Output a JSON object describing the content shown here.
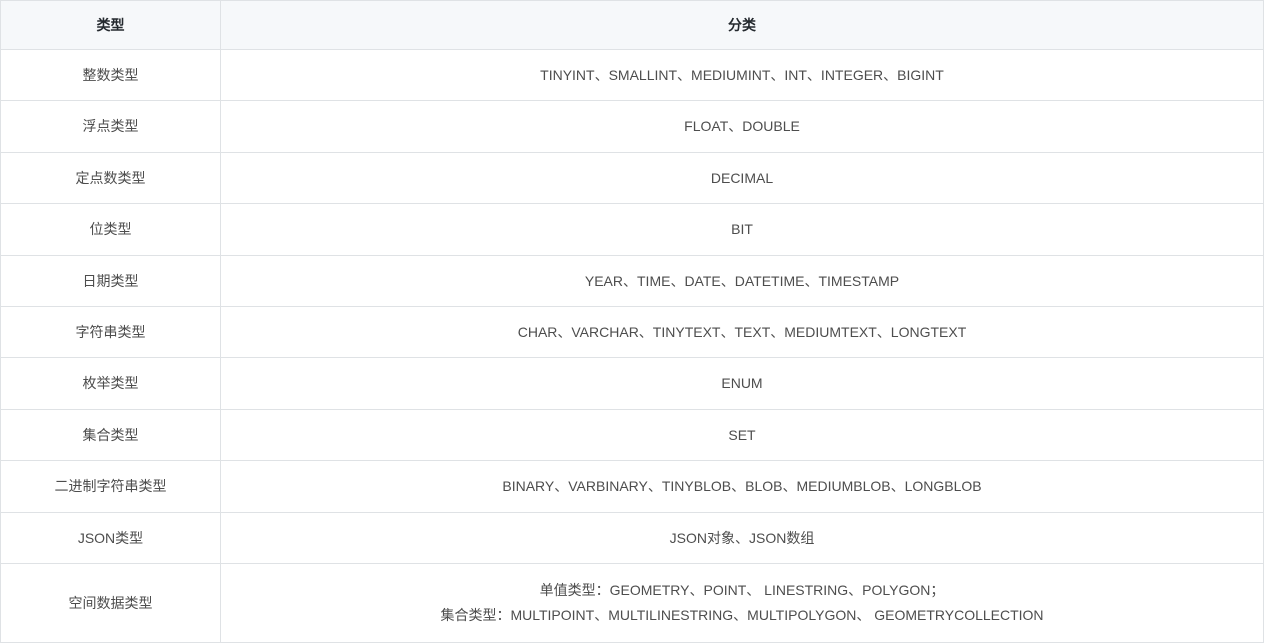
{
  "table": {
    "headers": {
      "col1": "类型",
      "col2": "分类"
    },
    "rows": [
      {
        "type": "整数类型",
        "category": "TINYINT、SMALLINT、MEDIUMINT、INT、INTEGER、BIGINT"
      },
      {
        "type": "浮点类型",
        "category": "FLOAT、DOUBLE"
      },
      {
        "type": "定点数类型",
        "category": "DECIMAL"
      },
      {
        "type": "位类型",
        "category": "BIT"
      },
      {
        "type": "日期类型",
        "category": "YEAR、TIME、DATE、DATETIME、TIMESTAMP"
      },
      {
        "type": "字符串类型",
        "category": "CHAR、VARCHAR、TINYTEXT、TEXT、MEDIUMTEXT、LONGTEXT"
      },
      {
        "type": "枚举类型",
        "category": "ENUM"
      },
      {
        "type": "集合类型",
        "category": "SET"
      },
      {
        "type": "二进制字符串类型",
        "category": "BINARY、VARBINARY、TINYBLOB、BLOB、MEDIUMBLOB、LONGBLOB"
      },
      {
        "type": "JSON类型",
        "category": "JSON对象、JSON数组"
      },
      {
        "type": "空间数据类型",
        "category_line1": "单值类型：GEOMETRY、POINT、 LINESTRING、POLYGON；",
        "category_line2": "集合类型：MULTIPOINT、MULTILINESTRING、MULTIPOLYGON、 GEOMETRYCOLLECTION",
        "multiline": true
      }
    ]
  }
}
